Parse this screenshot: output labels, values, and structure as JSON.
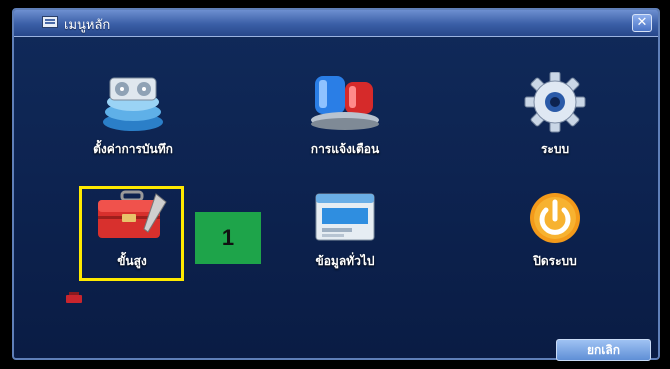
{
  "window": {
    "title": "เมนูหลัก",
    "close_symbol": "✕"
  },
  "menu": {
    "items": [
      {
        "label": "ตั้งค่าการบันทึก",
        "icon": "film-reel-icon"
      },
      {
        "label": "การแจ้งเตือน",
        "icon": "alarm-siren-icon"
      },
      {
        "label": "ระบบ",
        "icon": "gear-icon"
      },
      {
        "label": "ขั้นสูง",
        "icon": "toolbox-icon"
      },
      {
        "label": "ข้อมูลทั่วไป",
        "icon": "info-window-icon"
      },
      {
        "label": "ปิดระบบ",
        "icon": "power-icon"
      }
    ]
  },
  "annotation": {
    "badge_text": "1",
    "highlight_color": "#ffea00",
    "badge_color": "#1ea44a"
  },
  "footer": {
    "cancel_label": "ยกเลิก"
  }
}
